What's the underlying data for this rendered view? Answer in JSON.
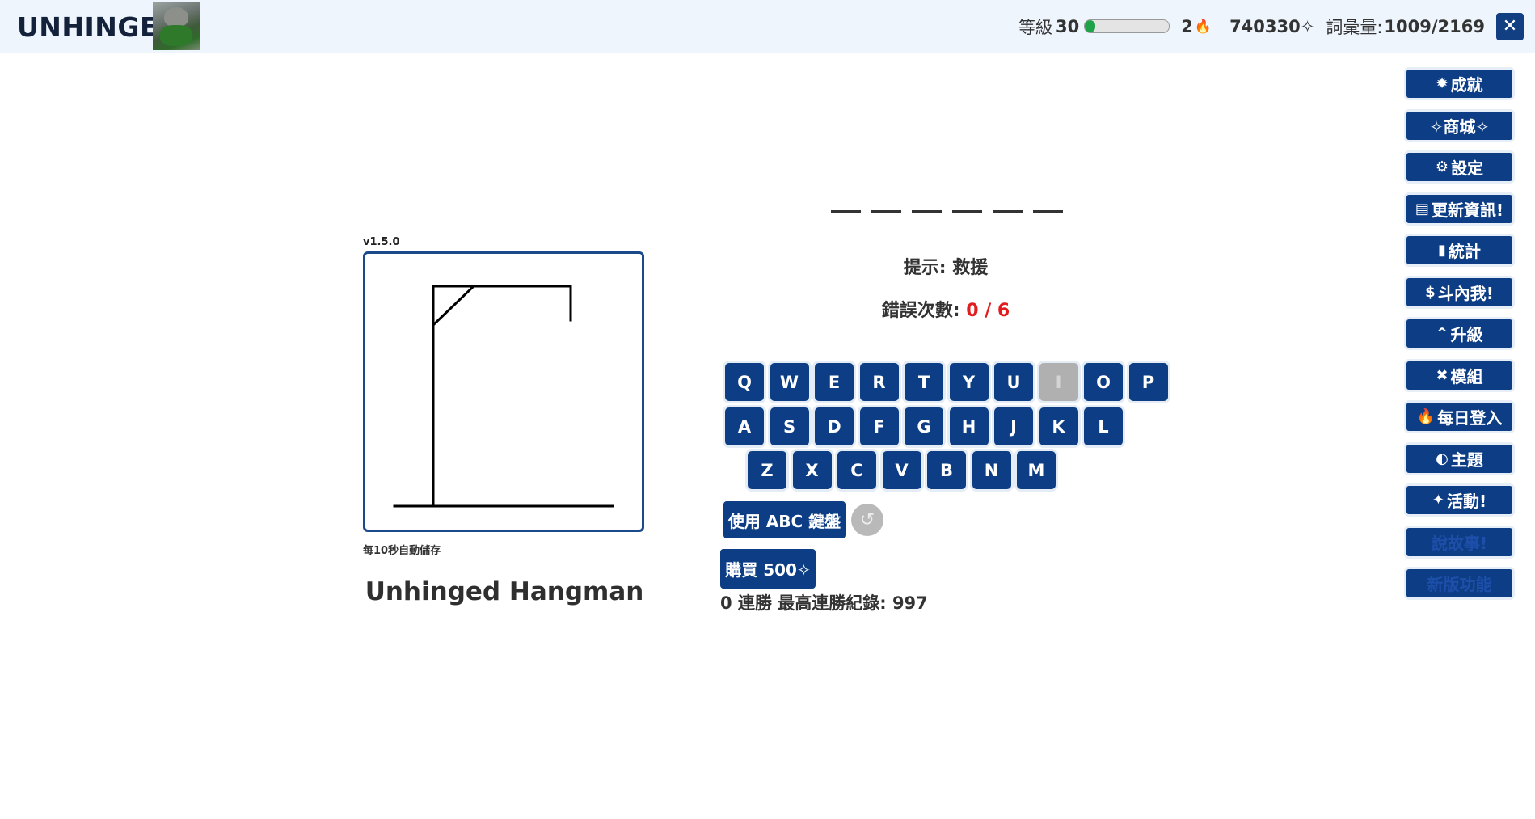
{
  "header": {
    "brand": "UNHINGED",
    "level_label": "等級",
    "level_value": "30",
    "xp_progress": 0.12,
    "streak_value": "2",
    "coins": "740330✧",
    "vocab_label": "詞彙量:",
    "vocab_value": "1009/2169",
    "close_label": "✕"
  },
  "game": {
    "version": "v1.5.0",
    "autosave_note": "每10秒自動儲存",
    "title": "Unhinged Hangman",
    "blanks_count": 6,
    "hint": "提示: 救援",
    "wrong_label": "錯誤次數: ",
    "wrong_count": "0 / 6"
  },
  "keyboard": {
    "rows": [
      [
        "Q",
        "W",
        "E",
        "R",
        "T",
        "Y",
        "U",
        "I",
        "O",
        "P"
      ],
      [
        "A",
        "S",
        "D",
        "F",
        "G",
        "H",
        "J",
        "K",
        "L"
      ],
      [
        "Z",
        "X",
        "C",
        "V",
        "B",
        "N",
        "M"
      ]
    ],
    "used_keys": [
      "I"
    ],
    "abc_button": "使用 ABC 鍵盤",
    "undo_icon": "↺"
  },
  "shop": {
    "buy_button": "購買 500✧",
    "record_text": "0 連勝 最高連勝紀錄: 997"
  },
  "sidebar": {
    "items": [
      {
        "icon": "✹",
        "label": "成就"
      },
      {
        "icon": "",
        "label": "✧商城✧"
      },
      {
        "icon": "⚙",
        "label": "設定"
      },
      {
        "icon": "▤",
        "label": "更新資訊!"
      },
      {
        "icon": "▮",
        "label": "統計"
      },
      {
        "icon": "$",
        "label": " 斗內我!"
      },
      {
        "icon": "^",
        "label": "升級"
      },
      {
        "icon": "✖",
        "label": "模組"
      },
      {
        "icon": "🔥",
        "label": " 每日登入"
      },
      {
        "icon": "◐",
        "label": "主題"
      },
      {
        "icon": "✦",
        "label": " 活動!"
      },
      {
        "icon": "",
        "label": "說故事!"
      },
      {
        "icon": "",
        "label": "新版功能"
      }
    ]
  },
  "colors": {
    "accent": "#0d3e85",
    "error": "#e11d1d",
    "xp_fill": "#1fa34a"
  }
}
